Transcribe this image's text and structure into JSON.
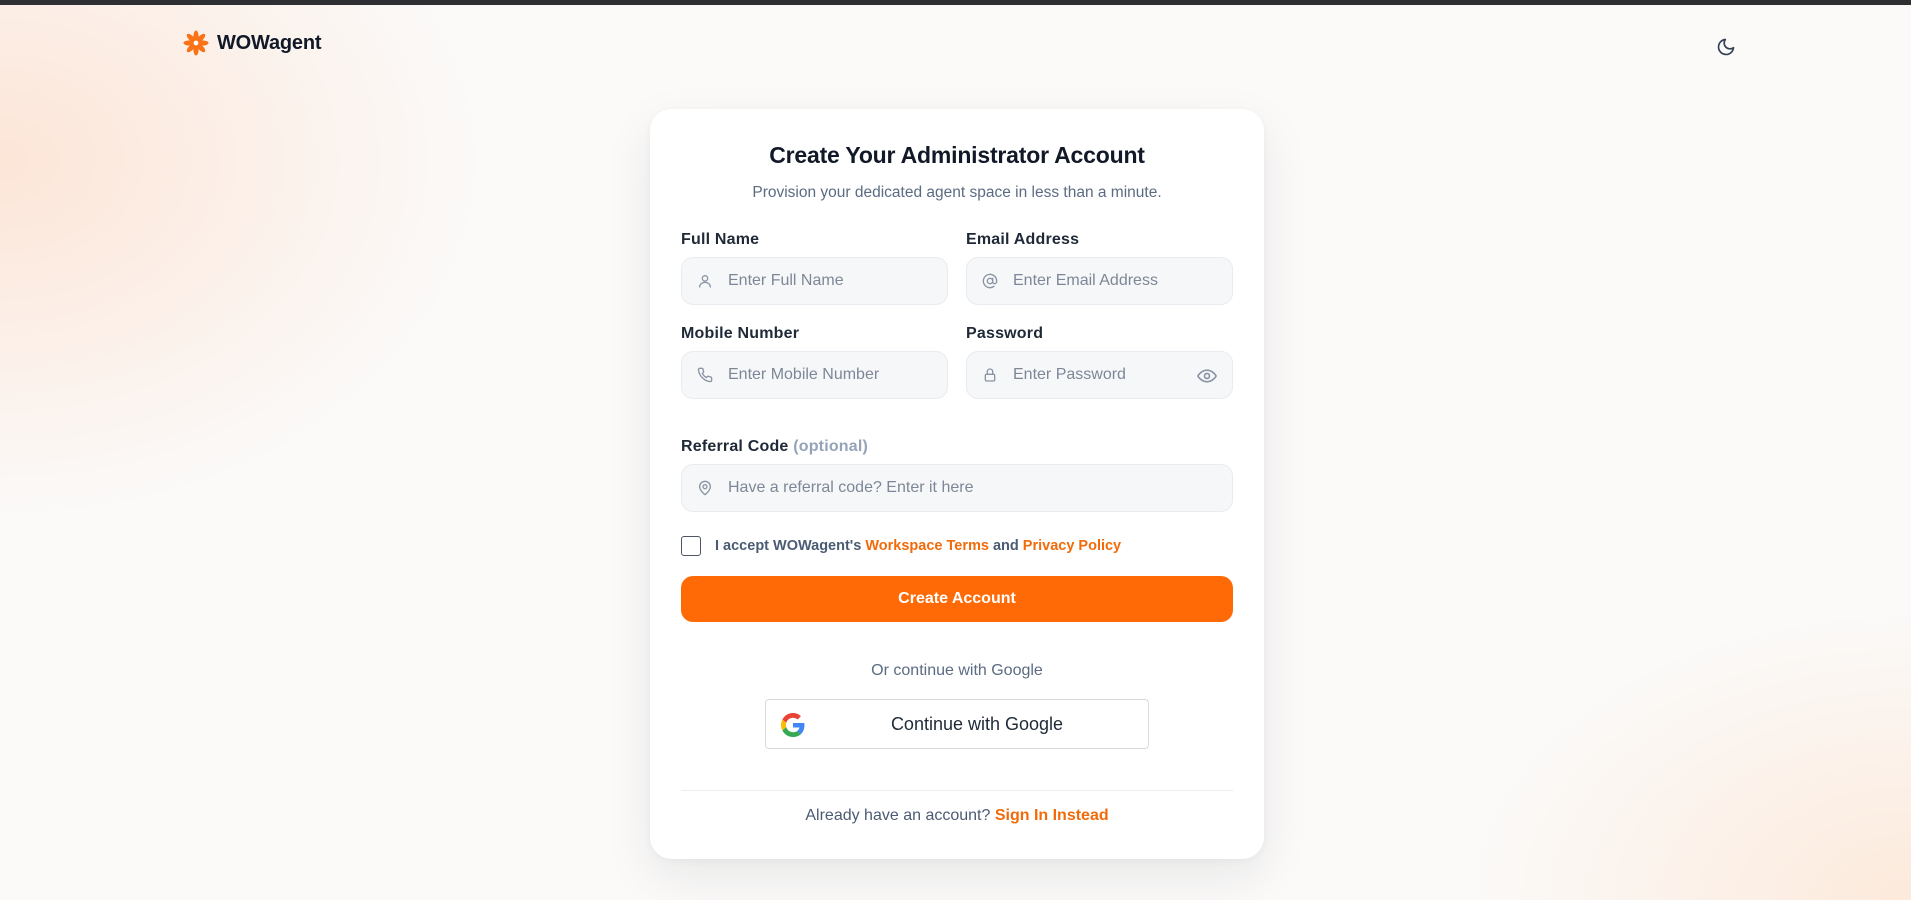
{
  "brand": {
    "name": "WOWagent",
    "logo_icon": "orange-flower-icon",
    "accent": "#f97316"
  },
  "header": {
    "theme_toggle_icon": "moon-icon"
  },
  "form": {
    "title": "Create Your Administrator Account",
    "subtitle": "Provision your dedicated agent space in less than a minute.",
    "full_name": {
      "label": "Full Name",
      "placeholder": "Enter Full Name",
      "icon": "user-icon"
    },
    "email": {
      "label": "Email Address",
      "placeholder": "Enter Email Address",
      "icon": "at-sign-icon"
    },
    "mobile": {
      "label": "Mobile Number",
      "placeholder": "Enter Mobile Number",
      "icon": "phone-icon"
    },
    "password": {
      "label": "Password",
      "placeholder": "Enter Password",
      "icon": "lock-icon",
      "toggle_icon": "eye-icon"
    },
    "referral": {
      "label": "Referral Code",
      "optional": "(optional)",
      "placeholder": "Have a referral code? Enter it here",
      "icon": "map-pin-icon"
    },
    "terms": {
      "prefix": "I accept WOWagent's",
      "link1": "Workspace Terms",
      "and": "and",
      "link2": "Privacy Policy",
      "checked": false
    },
    "submit_label": "Create Account",
    "or_text": "Or continue with Google",
    "google_label": "Continue with Google",
    "signin_prompt": "Already have an account?",
    "signin_link": "Sign In Instead"
  },
  "colors": {
    "primary": "#ff6a06",
    "link": "#f26b0a",
    "muted": "#5b6b82"
  }
}
